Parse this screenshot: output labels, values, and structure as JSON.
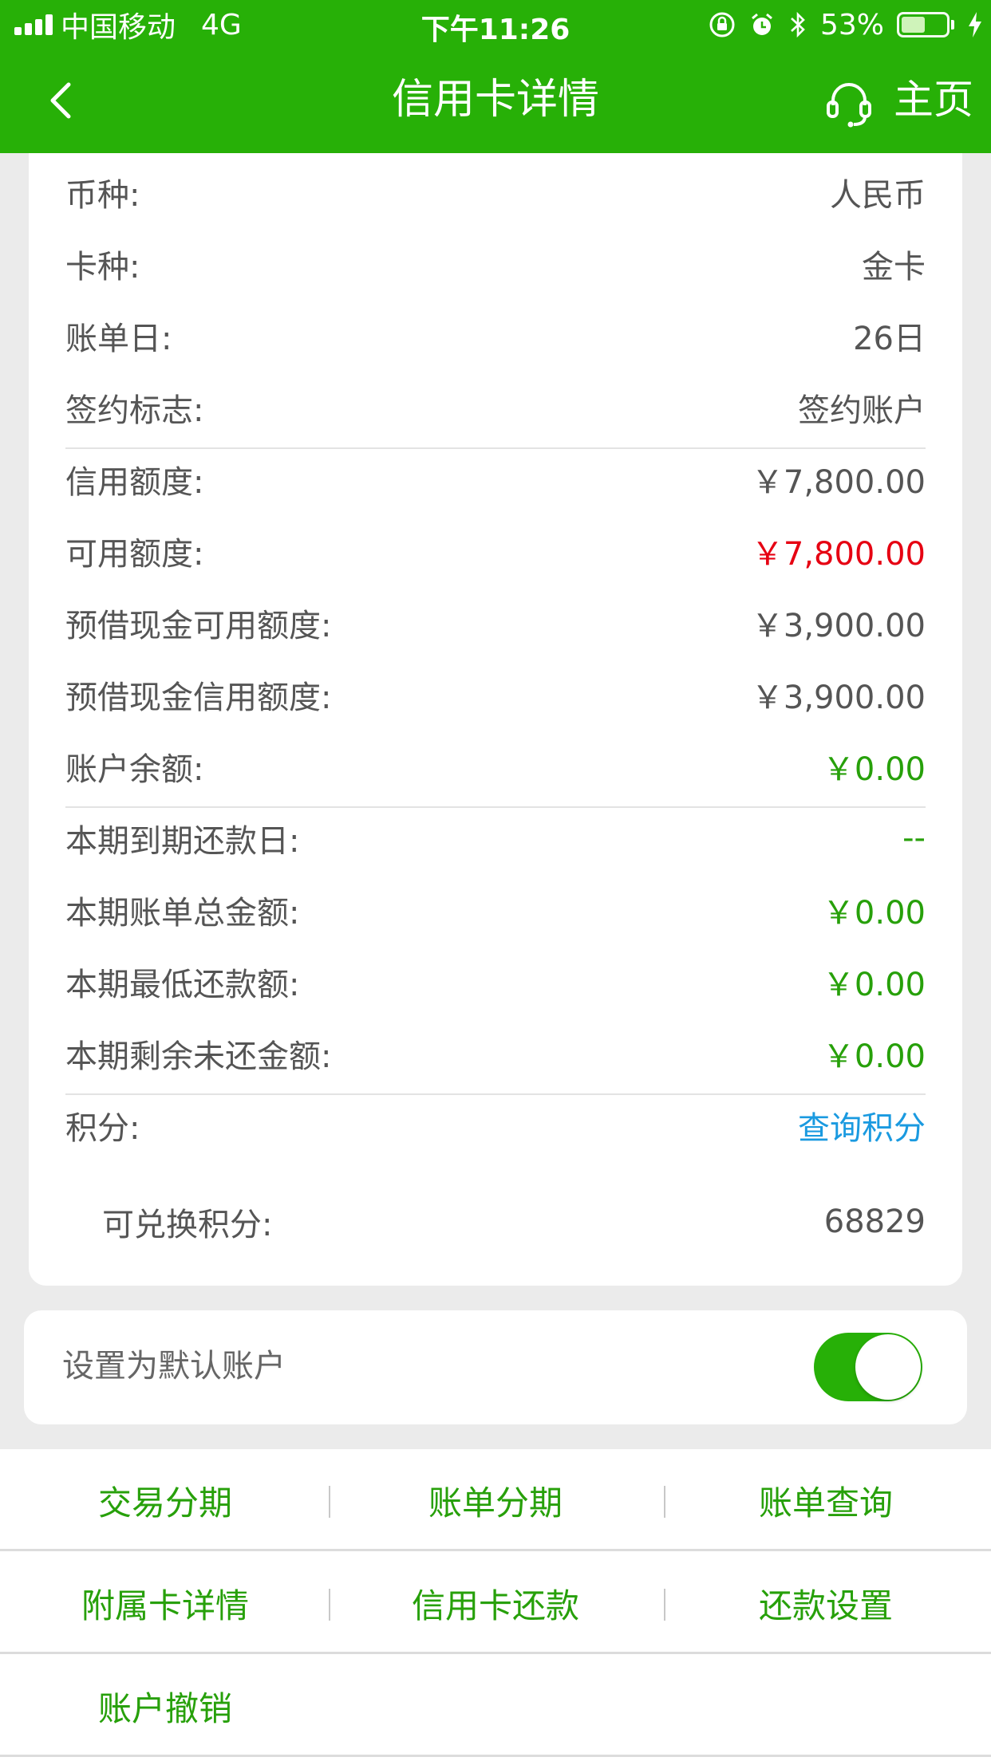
{
  "status_bar": {
    "carrier": "中国移动",
    "network": "4G",
    "time": "下午11:26",
    "battery": "53%",
    "battery_level": 0.53,
    "icons": [
      "signal-icon",
      "orientation-lock-icon",
      "alarm-icon",
      "bluetooth-icon",
      "battery-icon",
      "charging-icon"
    ]
  },
  "nav": {
    "title": "信用卡详情",
    "home_label": "主页",
    "back_icon": "chevron-left-icon",
    "service_icon": "headset-icon"
  },
  "details": [
    {
      "label": "币种:",
      "value": "人民币",
      "color": "#555555"
    },
    {
      "label": "卡种:",
      "value": "金卡",
      "color": "#555555"
    },
    {
      "label": "账单日:",
      "value": "26日",
      "color": "#555555"
    },
    {
      "label": "签约标志:",
      "value": "签约账户",
      "color": "#555555"
    },
    {
      "label": "信用额度:",
      "value": "￥7,800.00",
      "color": "#555555"
    },
    {
      "label": "可用额度:",
      "value": "￥7,800.00",
      "color": "#e60012"
    },
    {
      "label": "预借现金可用额度:",
      "value": "￥3,900.00",
      "color": "#555555"
    },
    {
      "label": "预借现金信用额度:",
      "value": "￥3,900.00",
      "color": "#555555"
    },
    {
      "label": "账户余额:",
      "value": "￥0.00",
      "color": "#27a00a"
    },
    {
      "label": "本期到期还款日:",
      "value": "--",
      "color": "#27a00a"
    },
    {
      "label": "本期账单总金额:",
      "value": "￥0.00",
      "color": "#27a00a"
    },
    {
      "label": "本期最低还款额:",
      "value": "￥0.00",
      "color": "#27a00a"
    },
    {
      "label": "本期剩余未还金额:",
      "value": "￥0.00",
      "color": "#27a00a"
    },
    {
      "label": "积分:",
      "value": "查询积分",
      "color": "#1a9ae0"
    },
    {
      "label": "可兑换积分:",
      "value": "68829",
      "color": "#555555"
    }
  ],
  "default_account": {
    "label": "设置为默认账户",
    "enabled": true,
    "accent": "#27b007"
  },
  "actions": [
    [
      "交易分期",
      "账单分期",
      "账单查询"
    ],
    [
      "附属卡详情",
      "信用卡还款",
      "还款设置"
    ],
    [
      "账户撤销"
    ]
  ]
}
